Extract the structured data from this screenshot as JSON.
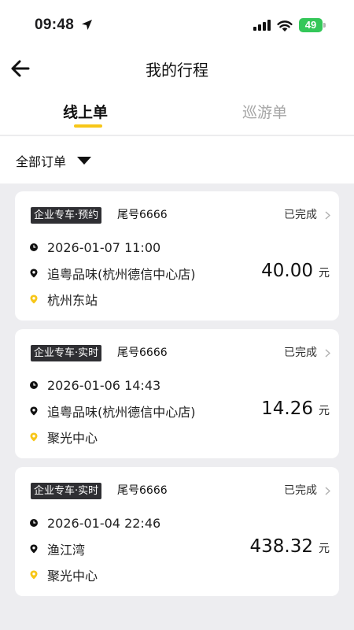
{
  "status_bar": {
    "time": "09:48",
    "battery": "49"
  },
  "nav": {
    "title": "我的行程"
  },
  "tabs": [
    {
      "label": "线上单",
      "active": true
    },
    {
      "label": "巡游单",
      "active": false
    }
  ],
  "filter": {
    "label": "全部订单"
  },
  "colors": {
    "accent": "#f7c618",
    "badge_bg": "#2f2f33",
    "battery": "#34c759"
  },
  "orders": [
    {
      "type": "企业专车·预约",
      "tail": "尾号6666",
      "status": "已完成",
      "time": "2026-01-07 11:00",
      "from": "追粤品味(杭州德信中心店)",
      "to": "杭州东站",
      "price": "40.00",
      "unit": "元"
    },
    {
      "type": "企业专车·实时",
      "tail": "尾号6666",
      "status": "已完成",
      "time": "2026-01-06 14:43",
      "from": "追粤品味(杭州德信中心店)",
      "to": "聚光中心",
      "price": "14.26",
      "unit": "元"
    },
    {
      "type": "企业专车·实时",
      "tail": "尾号6666",
      "status": "已完成",
      "time": "2026-01-04 22:46",
      "from": "渔江湾",
      "to": "聚光中心",
      "price": "438.32",
      "unit": "元"
    }
  ]
}
